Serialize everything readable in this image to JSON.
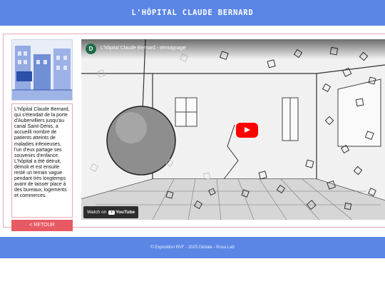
{
  "header": {
    "title": "L'HÔPITAL CLAUDE BERNARD"
  },
  "sidebar": {
    "description": "L'hôpital Claude Bernard, qui s'étendait de la porte d'Aubervilliers jusqu'au canal Saint-Denis, a accueilli nombre de patients atteints de maladies infexieuses, l'un d'eux partage ses souvenirs d'enfance. L'hôpital a été détruit, démoli et est ensuite resté un terrain vague pendant très longtemps avant de laisser place à des bureaux, logements et commerces.",
    "back_label": "< RETOUR",
    "thumbnail_icon": "building-illustration",
    "thumbnail_sign": "Hôpital Claude Bernard"
  },
  "video": {
    "channel_initial": "D",
    "title": "L'hôpital Claude Bernard - témoignage",
    "watch_on": "Watch on",
    "youtube": "YouTube"
  },
  "footer": {
    "text": "© Exposition RVF - 2025 Dédale - Rosa Lab"
  },
  "colors": {
    "header": "#5b86e5",
    "back_button": "#e85a63",
    "play": "#ff0000",
    "border": "#e4a9b4"
  }
}
